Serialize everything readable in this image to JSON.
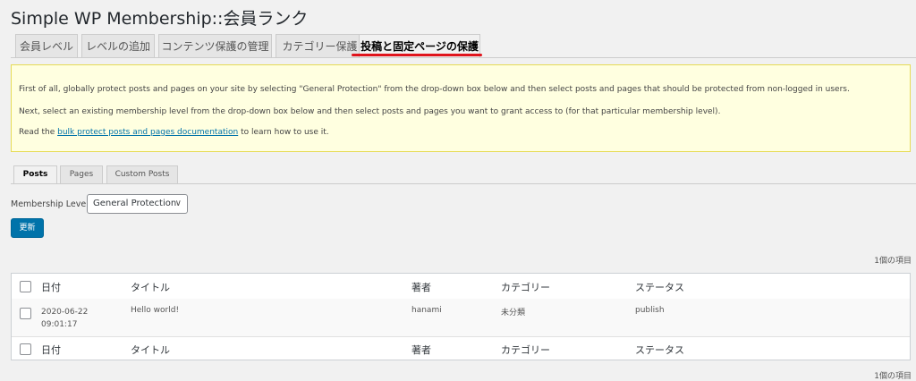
{
  "header": {
    "title": "Simple WP Membership::会員ランク"
  },
  "main_tabs": [
    {
      "label": "会員レベル"
    },
    {
      "label": "レベルの追加"
    },
    {
      "label": "コンテンツ保護の管理"
    },
    {
      "label": "カテゴリー保護"
    },
    {
      "label": "投稿と固定ページの保護",
      "active": true
    }
  ],
  "accent_colors": {
    "highlight_underline": "#e0141c",
    "link": "#0073aa",
    "primary_button": "#0073aa",
    "notice_bg": "#ffffe0"
  },
  "notice": {
    "line1": "First of all, globally protect posts and pages on your site by selecting \"General Protection\" from the drop-down box below and then select posts and pages that should be protected from non-logged in users.",
    "line2": "Next, select an existing membership level from the drop-down box below and then select posts and pages you want to grant access to (for that particular membership level).",
    "line3_prefix": "Read the ",
    "line3_link": "bulk protect posts and pages documentation",
    "line3_suffix": " to learn how to use it."
  },
  "sub_tabs": [
    {
      "label": "Posts",
      "active": true
    },
    {
      "label": "Pages"
    },
    {
      "label": "Custom Posts"
    }
  ],
  "form": {
    "membership_label": "Membership Level:",
    "membership_value": "General Protection",
    "update_button": "更新"
  },
  "items_count": "1個の項目",
  "table": {
    "columns": [
      "日付",
      "タイトル",
      "著者",
      "カテゴリー",
      "ステータス"
    ],
    "rows": [
      {
        "date": "2020-06-22",
        "time": "09:01:17",
        "title": "Hello world!",
        "author": "hanami",
        "category": "未分類",
        "status": "publish"
      }
    ]
  }
}
